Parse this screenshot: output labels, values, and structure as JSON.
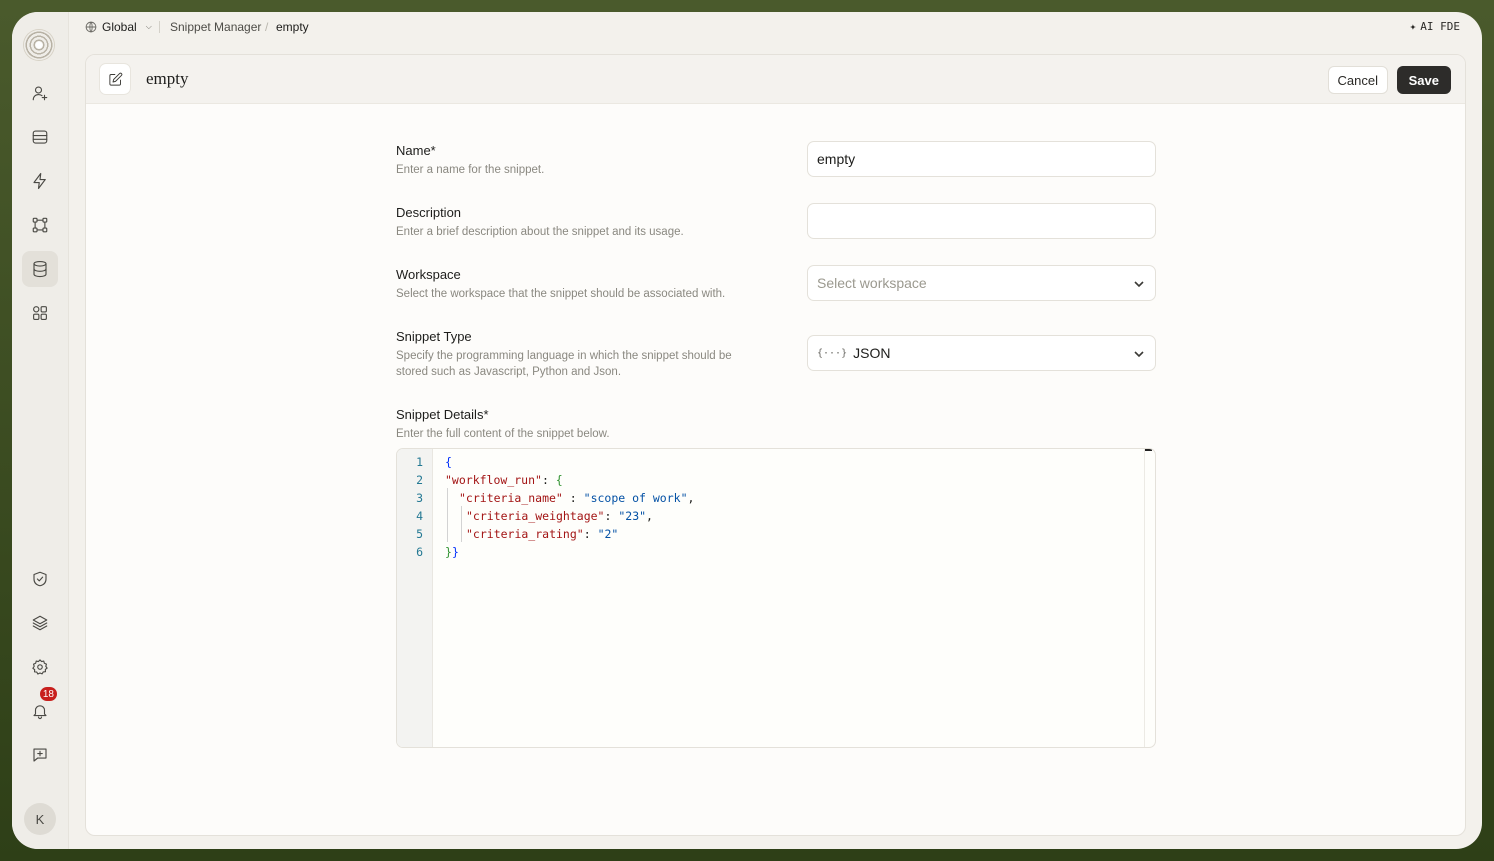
{
  "breadcrumb": {
    "workspace": "Global",
    "section": "Snippet Manager",
    "current": "empty"
  },
  "topbar": {
    "ai_label": "AI FDE"
  },
  "sidebar": {
    "items": [
      {
        "icon": "user-plus-icon"
      },
      {
        "icon": "inbox-icon"
      },
      {
        "icon": "bolt-icon"
      },
      {
        "icon": "workflow-icon"
      },
      {
        "icon": "database-icon",
        "active": true
      },
      {
        "icon": "apps-icon"
      },
      {
        "icon": "shield-check-icon"
      },
      {
        "icon": "layers-icon"
      },
      {
        "icon": "gear-icon"
      },
      {
        "icon": "bell-icon",
        "badge": "18"
      },
      {
        "icon": "feedback-icon"
      }
    ],
    "avatar_initial": "K"
  },
  "header": {
    "title": "empty",
    "cancel_label": "Cancel",
    "save_label": "Save"
  },
  "form": {
    "name": {
      "label": "Name*",
      "help": "Enter a name for the snippet.",
      "value": "empty"
    },
    "description": {
      "label": "Description",
      "help": "Enter a brief description about the snippet and its usage.",
      "value": ""
    },
    "workspace": {
      "label": "Workspace",
      "help": "Select the workspace that the snippet should be associated with.",
      "placeholder": "Select workspace"
    },
    "snippet_type": {
      "label": "Snippet Type",
      "help_line1": "Specify the programming language in which the snippet should be",
      "help_line2": "stored such as Javascript, Python and Json.",
      "icon_text": "{···}",
      "value": "JSON"
    },
    "details": {
      "label": "Snippet Details*",
      "help": "Enter the full content of the snippet below."
    }
  },
  "editor": {
    "line_numbers": [
      "1",
      "2",
      "3",
      "4",
      "5",
      "6"
    ],
    "lines": [
      {
        "brace_open": "{"
      },
      {
        "key": "\"workflow_run\"",
        "sep": ": ",
        "brace": "{"
      },
      {
        "key": "\"criteria_name\"",
        "sep": " : ",
        "value": "\"scope of work\"",
        "end": ","
      },
      {
        "key": "\"criteria_weightage\"",
        "sep": ": ",
        "value": "\"23\"",
        "end": ","
      },
      {
        "key": "\"criteria_rating\"",
        "sep": ": ",
        "value": "\"2\"",
        "end": ""
      },
      {
        "close_inner": "}",
        "close_outer": "}"
      }
    ]
  },
  "colors": {
    "key": "#a31515",
    "string": "#0451a5",
    "brace_level1": "#0431fa",
    "brace_level2": "#319331",
    "line_number": "#237893",
    "badge": "#c8201d",
    "save_button": "#2d2c2a"
  }
}
